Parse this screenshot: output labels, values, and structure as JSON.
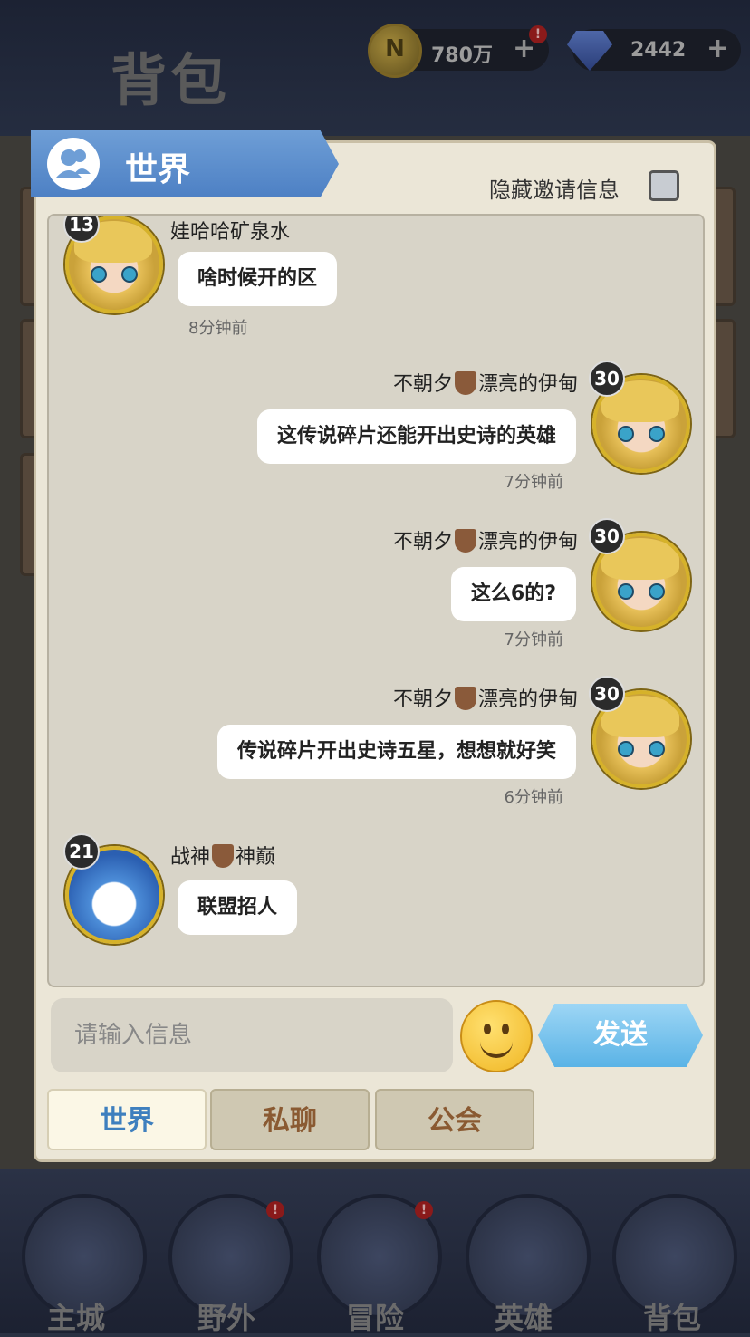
{
  "header": {
    "title": "背包",
    "coins": {
      "icon": "coin-icon",
      "value": "780万"
    },
    "gems": {
      "icon": "gem-icon",
      "value": "2442"
    },
    "plus": "+"
  },
  "chat_panel": {
    "channel_title": "世界",
    "hide_invites_label": "隐藏邀请信息",
    "messages": [
      {
        "level": "13",
        "name": "娃哈哈矿泉水",
        "text": "啥时候开的区",
        "time": "8分钟前",
        "side": "left"
      },
      {
        "level": "30",
        "name_a": "不朝夕",
        "name_b": "漂亮的伊甸",
        "text": "这传说碎片还能开出史诗的英雄",
        "time": "7分钟前",
        "side": "right"
      },
      {
        "level": "30",
        "name_a": "不朝夕",
        "name_b": "漂亮的伊甸",
        "text": "这么6的?",
        "time": "7分钟前",
        "side": "right"
      },
      {
        "level": "30",
        "name_a": "不朝夕",
        "name_b": "漂亮的伊甸",
        "text": "传说碎片开出史诗五星，想想就好笑",
        "time": "6分钟前",
        "side": "right"
      },
      {
        "level": "21",
        "name_a": "战神",
        "name_b": "神巅",
        "text": "联盟招人",
        "time": "",
        "side": "left"
      }
    ],
    "input_placeholder": "请输入信息",
    "send_label": "发送",
    "tabs": [
      "世界",
      "私聊",
      "公会"
    ]
  },
  "nav": {
    "items": [
      "主城",
      "野外",
      "冒险",
      "英雄",
      "背包"
    ]
  },
  "colors": {
    "accent_blue": "#5ab3e6",
    "panel_bg": "#ebe6d7",
    "tab_active_text": "#3e7fbe"
  }
}
